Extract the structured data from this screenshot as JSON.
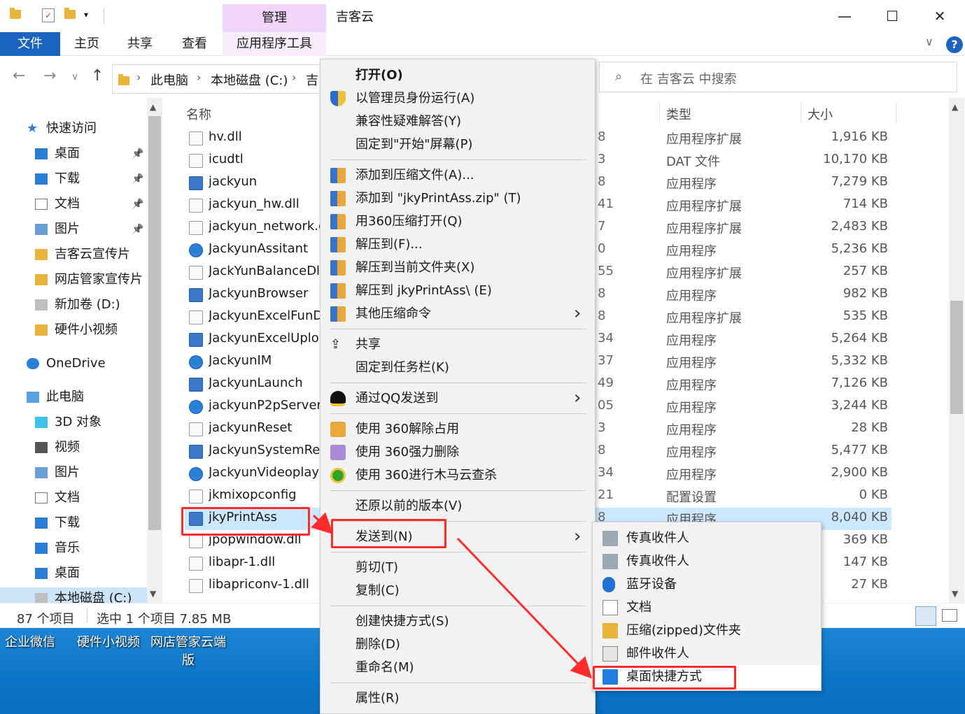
{
  "window": {
    "title": "吉客云",
    "manage_tab": "管理",
    "minimize": "—",
    "maximize": "☐",
    "close": "✕"
  },
  "ribbon": {
    "tabs": [
      "文件",
      "主页",
      "共享",
      "查看",
      "应用程序工具"
    ],
    "expand": "∨",
    "help": "?"
  },
  "nav": {
    "back": "←",
    "forward": "→",
    "recent": "∨",
    "up": "↑",
    "breadcrumb": [
      "此电脑",
      "本地磁盘 (C:)",
      "吉"
    ],
    "search_placeholder": "在 吉客云 中搜索"
  },
  "sidebar": {
    "items": [
      {
        "label": "快速访问",
        "icon": "star-icon",
        "pinned": false,
        "top": true
      },
      {
        "label": "桌面",
        "icon": "desktop-icon",
        "pinned": true
      },
      {
        "label": "下载",
        "icon": "download-icon",
        "pinned": true
      },
      {
        "label": "文档",
        "icon": "document-icon",
        "pinned": true
      },
      {
        "label": "图片",
        "icon": "picture-icon",
        "pinned": true
      },
      {
        "label": "吉客云宣传片",
        "icon": "folder-icon",
        "pinned": false
      },
      {
        "label": "网店管家宣传片",
        "icon": "folder-icon",
        "pinned": false
      },
      {
        "label": "新加卷 (D:)",
        "icon": "drive-icon",
        "pinned": false
      },
      {
        "label": "硬件小视频",
        "icon": "folder-icon",
        "pinned": false
      },
      {
        "label": "OneDrive",
        "icon": "cloud-icon",
        "pinned": false,
        "top": true
      },
      {
        "label": "此电脑",
        "icon": "computer-icon",
        "pinned": false,
        "top": true
      },
      {
        "label": "3D 对象",
        "icon": "cube-icon",
        "pinned": false
      },
      {
        "label": "视频",
        "icon": "video-icon",
        "pinned": false
      },
      {
        "label": "图片",
        "icon": "picture-icon",
        "pinned": false
      },
      {
        "label": "文档",
        "icon": "document-icon",
        "pinned": false
      },
      {
        "label": "下载",
        "icon": "download-icon",
        "pinned": false
      },
      {
        "label": "音乐",
        "icon": "music-icon",
        "pinned": false
      },
      {
        "label": "桌面",
        "icon": "desktop-icon",
        "pinned": false
      },
      {
        "label": "本地磁盘 (C:)",
        "icon": "drive-icon",
        "pinned": false,
        "selected": true
      }
    ]
  },
  "filelist": {
    "headers": {
      "name": "名称",
      "type": "类型",
      "size": "大小"
    },
    "rows": [
      {
        "name": "hv.dll",
        "date": "8",
        "type": "应用程序扩展",
        "size": "1,916 KB",
        "icon": "dll"
      },
      {
        "name": "icudtl",
        "date": "3",
        "type": "DAT 文件",
        "size": "10,170 KB",
        "icon": "dat"
      },
      {
        "name": "jackyun",
        "date": "8",
        "type": "应用程序",
        "size": "7,279 KB",
        "icon": "app"
      },
      {
        "name": "jackyun_hw.dll",
        "date": "41",
        "type": "应用程序扩展",
        "size": "714 KB",
        "icon": "dll"
      },
      {
        "name": "jackyun_network.d",
        "date": "7",
        "type": "应用程序扩展",
        "size": "2,483 KB",
        "icon": "dll"
      },
      {
        "name": "JackyunAssitant",
        "date": "0",
        "type": "应用程序",
        "size": "5,236 KB",
        "icon": "q"
      },
      {
        "name": "JackYunBalanceDll",
        "date": "55",
        "type": "应用程序扩展",
        "size": "257 KB",
        "icon": "dll"
      },
      {
        "name": "JackyunBrowser",
        "date": "8",
        "type": "应用程序",
        "size": "982 KB",
        "icon": "app"
      },
      {
        "name": "JackyunExcelFunD",
        "date": "8",
        "type": "应用程序扩展",
        "size": "535 KB",
        "icon": "dll"
      },
      {
        "name": "JackyunExcelUploa",
        "date": "34",
        "type": "应用程序",
        "size": "5,264 KB",
        "icon": "app"
      },
      {
        "name": "JackyunIM",
        "date": "37",
        "type": "应用程序",
        "size": "5,332 KB",
        "icon": "q"
      },
      {
        "name": "JackyunLaunch",
        "date": "49",
        "type": "应用程序",
        "size": "7,126 KB",
        "icon": "app"
      },
      {
        "name": "jackyunP2pServer",
        "date": "05",
        "type": "应用程序",
        "size": "3,244 KB",
        "icon": "q"
      },
      {
        "name": "jackyunReset",
        "date": "3",
        "type": "应用程序",
        "size": "28 KB",
        "icon": "dll"
      },
      {
        "name": "JackyunSystemRep",
        "date": "8",
        "type": "应用程序",
        "size": "5,477 KB",
        "icon": "app"
      },
      {
        "name": "JackyunVideoplaye",
        "date": "34",
        "type": "应用程序",
        "size": "2,900 KB",
        "icon": "q"
      },
      {
        "name": "jkmixopconfig",
        "date": "21",
        "type": "配置设置",
        "size": "0 KB",
        "icon": "dat"
      },
      {
        "name": "jkyPrintAss",
        "date": "8",
        "type": "应用程序",
        "size": "8,040 KB",
        "icon": "app",
        "selected": true
      },
      {
        "name": "jpopwindow.dll",
        "date": "",
        "type": "",
        "size": "369 KB",
        "icon": "dll"
      },
      {
        "name": "libapr-1.dll",
        "date": "",
        "type": "",
        "size": "147 KB",
        "icon": "dll"
      },
      {
        "name": "libapriconv-1.dll",
        "date": "",
        "type": "",
        "size": "27 KB",
        "icon": "dll"
      }
    ]
  },
  "status": {
    "count": "87 个项目",
    "selection": "选中 1 个项目  7.85 MB"
  },
  "desktop": {
    "icons": [
      "企业微信",
      "硬件小视频",
      "网店管家云端版"
    ]
  },
  "context_menu": {
    "groups": [
      [
        {
          "label": "打开(O)",
          "bold": true,
          "icon": ""
        },
        {
          "label": "以管理员身份运行(A)",
          "icon": "shield-icon"
        },
        {
          "label": "兼容性疑难解答(Y)",
          "icon": ""
        },
        {
          "label": "固定到\"开始\"屏幕(P)",
          "icon": ""
        }
      ],
      [
        {
          "label": "添加到压缩文件(A)...",
          "icon": "zip-icon"
        },
        {
          "label": "添加到 \"jkyPrintAss.zip\" (T)",
          "icon": "zip-icon"
        },
        {
          "label": "用360压缩打开(Q)",
          "icon": "zip-icon"
        },
        {
          "label": "解压到(F)...",
          "icon": "zip-icon"
        },
        {
          "label": "解压到当前文件夹(X)",
          "icon": "zip-icon"
        },
        {
          "label": "解压到 jkyPrintAss\\ (E)",
          "icon": "zip-icon"
        },
        {
          "label": "其他压缩命令",
          "icon": "zip-icon",
          "submenu": true
        }
      ],
      [
        {
          "label": "共享",
          "icon": "share-icon"
        },
        {
          "label": "固定到任务栏(K)",
          "icon": ""
        }
      ],
      [
        {
          "label": "通过QQ发送到",
          "icon": "qq-icon",
          "submenu": true
        }
      ],
      [
        {
          "label": "使用 360解除占用",
          "icon": "unlock-360-icon"
        },
        {
          "label": "使用 360强力删除",
          "icon": "shred-360-icon"
        },
        {
          "label": "使用 360进行木马云查杀",
          "icon": "scan-360-icon"
        }
      ],
      [
        {
          "label": "还原以前的版本(V)",
          "icon": ""
        }
      ],
      [
        {
          "label": "发送到(N)",
          "icon": "",
          "submenu": true
        }
      ],
      [
        {
          "label": "剪切(T)",
          "icon": ""
        },
        {
          "label": "复制(C)",
          "icon": ""
        }
      ],
      [
        {
          "label": "创建快捷方式(S)",
          "icon": ""
        },
        {
          "label": "删除(D)",
          "icon": ""
        },
        {
          "label": "重命名(M)",
          "icon": ""
        }
      ],
      [
        {
          "label": "属性(R)",
          "icon": ""
        }
      ]
    ]
  },
  "send_to_menu": {
    "items": [
      {
        "label": "传真收件人",
        "icon": "fax-icon"
      },
      {
        "label": "传真收件人",
        "icon": "fax-icon"
      },
      {
        "label": "蓝牙设备",
        "icon": "bluetooth-icon"
      },
      {
        "label": "文档",
        "icon": "document-icon"
      },
      {
        "label": "压缩(zipped)文件夹",
        "icon": "zip-folder-icon"
      },
      {
        "label": "邮件收件人",
        "icon": "mail-icon"
      },
      {
        "label": "桌面快捷方式",
        "icon": "desktop-shortcut-icon",
        "highlighted": true
      }
    ]
  },
  "colors": {
    "accent": "#1a64bf",
    "manage_tab": "#f0d5fb",
    "selection": "#cce8ff",
    "annotation": "#ff2a2a"
  }
}
